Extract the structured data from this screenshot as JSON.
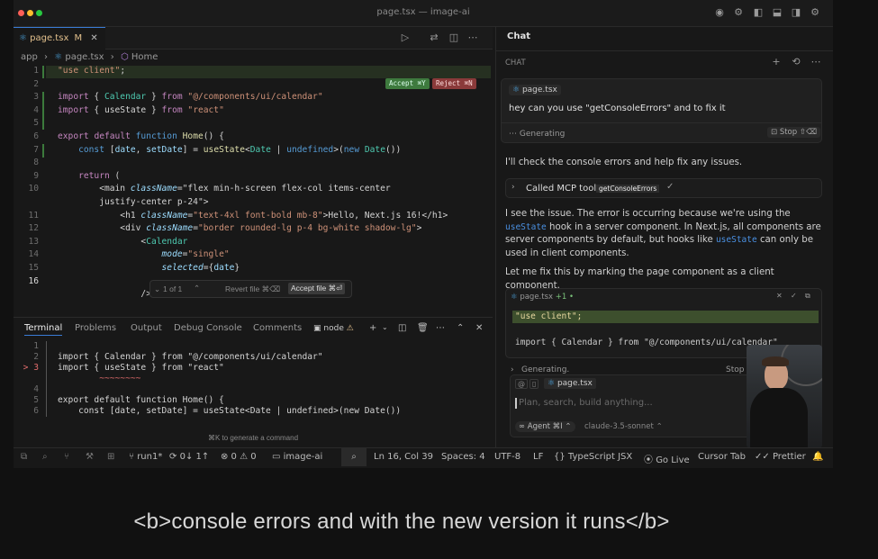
{
  "window": {
    "title": "page.tsx — image-ai"
  },
  "editor": {
    "tab_label": "page.tsx",
    "tab_modified": "M",
    "breadcrumb": [
      "app",
      "page.tsx",
      "Home"
    ],
    "accept_label": "Accept ⌘Y",
    "reject_label": "Reject ⌘N",
    "lines": [
      {
        "n": "1",
        "text": "\"use client\";"
      },
      {
        "n": "2",
        "text": ""
      },
      {
        "n": "3",
        "text": "import { Calendar } from \"@/components/ui/calendar\""
      },
      {
        "n": "4",
        "text": "import { useState } from \"react\""
      },
      {
        "n": "5",
        "text": ""
      },
      {
        "n": "6",
        "text": "export default function Home() {"
      },
      {
        "n": "7",
        "text": "    const [date, setDate] = useState<Date | undefined>(new Date())"
      },
      {
        "n": "8",
        "text": ""
      },
      {
        "n": "9",
        "text": "    return ("
      },
      {
        "n": "10",
        "text": "        <main className=\"flex min-h-screen flex-col items-center"
      },
      {
        "n": "",
        "text": "        justify-center p-24\">"
      },
      {
        "n": "11",
        "text": "            <h1 className=\"text-4xl font-bold mb-8\">Hello, Next.js 16!</h1>"
      },
      {
        "n": "12",
        "text": "            <div className=\"border rounded-lg p-4 bg-white shadow-lg\">"
      },
      {
        "n": "13",
        "text": "                <Calendar"
      },
      {
        "n": "14",
        "text": "                    mode=\"single\""
      },
      {
        "n": "15",
        "text": "                    selected={date}"
      },
      {
        "n": "16",
        "text": ""
      },
      {
        "n": "",
        "text": "                />"
      }
    ],
    "diff_bar": {
      "counter": "1 of 1",
      "revert_label": "Revert file ⌘⌫",
      "accept_file_label": "Accept file ⌘⏎"
    }
  },
  "panel": {
    "tabs": [
      "Terminal",
      "Problems",
      "Output",
      "Debug Console",
      "Comments"
    ],
    "terminal_name": "node",
    "lines": [
      {
        "n": "1",
        "text": ""
      },
      {
        "n": "2",
        "text": "import { Calendar } from \"@/components/ui/calendar\""
      },
      {
        "n": "3",
        "text": "import { useState } from \"react\""
      },
      {
        "n": "",
        "text": "        ~~~~~~~~"
      },
      {
        "n": "4",
        "text": ""
      },
      {
        "n": "5",
        "text": "export default function Home() {"
      },
      {
        "n": "6",
        "text": "    const [date, setDate] = useState<Date | undefined>(new Date())"
      }
    ],
    "generate_hint": "⌘K to generate a command"
  },
  "status_bar": {
    "branch": "run1*",
    "sync": "0↓ 1↑",
    "problems": "⊗ 0 ⚠ 0",
    "workspace": "image-ai",
    "position": "Ln 16, Col 39",
    "spaces": "Spaces: 4",
    "encoding": "UTF-8",
    "eol": "LF",
    "language": "TypeScript JSX",
    "golive": "Go Live",
    "cursor_tab": "Cursor Tab",
    "prettier": "Prettier"
  },
  "chat": {
    "header_tab": "Chat",
    "section_label": "CHAT",
    "user_msg_file": "page.tsx",
    "user_msg": "hey can you use \"getConsoleErrors\" and to fix it",
    "generating": "Generating",
    "stop_label": "Stop ⇧⌫",
    "reply1": "I'll check the console errors and help fix any issues.",
    "tool_called": "Called MCP tool",
    "tool_name": "getConsoleErrors",
    "reply2_a": "I see the issue. The error is occurring because we're using the ",
    "reply2_code1": "useState",
    "reply2_b": " hook in a server component. In Next.js, all components are server components by default, but hooks like ",
    "reply2_code2": "useState",
    "reply2_c": " can only be used in client components.",
    "reply3": "Let me fix this by marking the page component as a client component.",
    "edit_file": "page.tsx",
    "edit_count": "+1",
    "edit_line1": "\"use client\";",
    "edit_line2": "import { Calendar } from \"@/components/ui/calendar\"",
    "generating2": "Generating.",
    "stop2": "Stop",
    "input_file": "page.tsx",
    "input_placeholder": "Plan, search, build anything...",
    "agent_label": "Agent ⌘I",
    "model_label": "claude-3.5-sonnet"
  },
  "caption": "<b>console errors and with the new version it runs</b>",
  "colors": {
    "accent": "#3a7bd5",
    "accept_green": "#3e7a3e",
    "reject_red": "#8a3a3a"
  }
}
